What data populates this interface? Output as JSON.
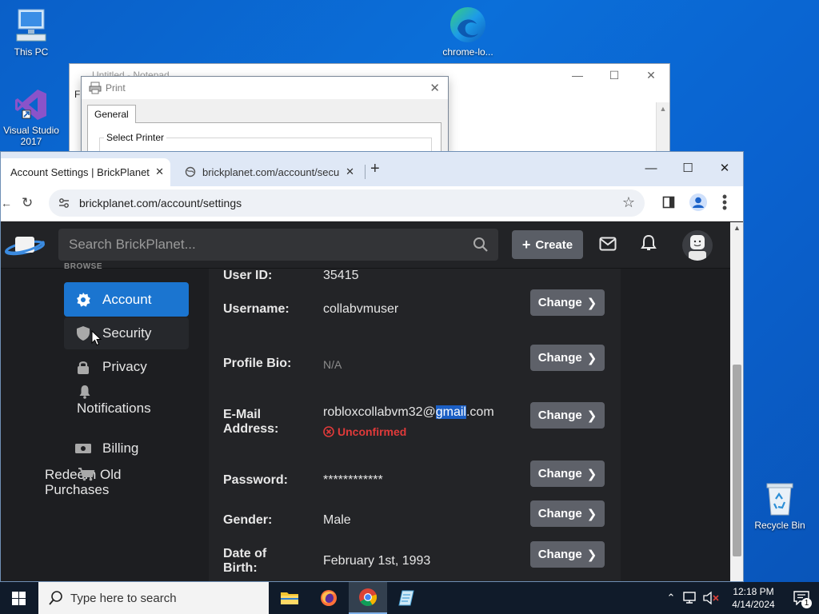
{
  "desktop": {
    "icons": {
      "this_pc": "This PC",
      "visual_studio": "Visual Studio 2017",
      "chrome_lo": "chrome-lo...",
      "recycle_bin": "Recycle Bin"
    }
  },
  "notepad": {
    "title": "Untitled - Notepad",
    "menu_first": "Fi"
  },
  "print_dialog": {
    "title": "Print",
    "tab": "General",
    "group_label": "Select Printer"
  },
  "browser": {
    "tabs": [
      {
        "label": "Account Settings | BrickPlanet",
        "active": true
      },
      {
        "label": "brickplanet.com/account/secu",
        "active": false
      }
    ],
    "url": "brickplanet.com/account/settings"
  },
  "site": {
    "search_placeholder": "Search BrickPlanet...",
    "create_label": "Create",
    "sidebar": {
      "section": "BROWSE",
      "items": [
        {
          "label": "Account",
          "icon": "gear-icon",
          "active": true
        },
        {
          "label": "Security",
          "icon": "shield-icon"
        },
        {
          "label": "Privacy",
          "icon": "lock-icon"
        },
        {
          "label": "Notifications",
          "icon": "bell-icon"
        },
        {
          "label": "Billing",
          "icon": "money-icon"
        },
        {
          "label": "Redeem Old Purchases",
          "icon": "cart-icon"
        }
      ]
    },
    "settings": {
      "user_id_label": "User ID:",
      "user_id": "35415",
      "username_label": "Username:",
      "username": "collabvmuser",
      "bio_label": "Profile Bio:",
      "bio": "N/A",
      "email_label_1": "E-Mail",
      "email_label_2": "Address:",
      "email_prefix": "robloxcollabvm32@",
      "email_selected": "gmail",
      "email_suffix": ".com",
      "email_status": "Unconfirmed",
      "password_label": "Password:",
      "password": "************",
      "gender_label": "Gender:",
      "gender": "Male",
      "dob_label_1": "Date of",
      "dob_label_2": "Birth:",
      "dob": "February 1st, 1993",
      "change_label": "Change"
    }
  },
  "taskbar": {
    "search_placeholder": "Type here to search",
    "time": "12:18 PM",
    "date": "4/14/2024",
    "notification_count": "1"
  },
  "colors": {
    "accent": "#1b75d0",
    "error": "#e03a3a",
    "selection": "#1b5fc5"
  }
}
